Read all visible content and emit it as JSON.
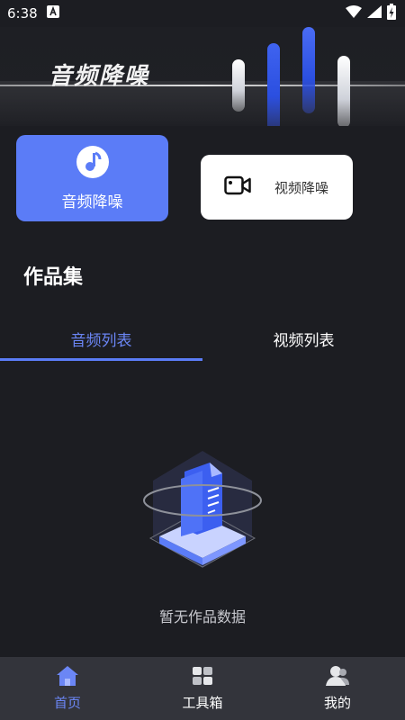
{
  "status_bar": {
    "time": "6:38",
    "icons": [
      "notification-a-icon",
      "wifi-icon",
      "signal-icon",
      "battery-charging-icon"
    ]
  },
  "header": {
    "title": "音频降噪"
  },
  "modes": {
    "audio": {
      "label": "音频降噪",
      "icon": "music-note-icon",
      "color": "#5b7cf7"
    },
    "video": {
      "label": "视频降噪",
      "icon": "video-camera-icon",
      "color": "#ffffff"
    }
  },
  "section": {
    "title": "作品集"
  },
  "tabs": {
    "items": [
      {
        "label": "音频列表",
        "active": true
      },
      {
        "label": "视频列表",
        "active": false
      }
    ],
    "accent": "#5b7cf7"
  },
  "empty_state": {
    "text": "暂无作品数据",
    "icon": "empty-document-icon"
  },
  "bottom_nav": {
    "items": [
      {
        "label": "首页",
        "icon": "home-icon",
        "active": true
      },
      {
        "label": "工具箱",
        "icon": "toolbox-icon",
        "active": false
      },
      {
        "label": "我的",
        "icon": "profile-icon",
        "active": false
      }
    ],
    "active_color": "#6b86f5"
  }
}
